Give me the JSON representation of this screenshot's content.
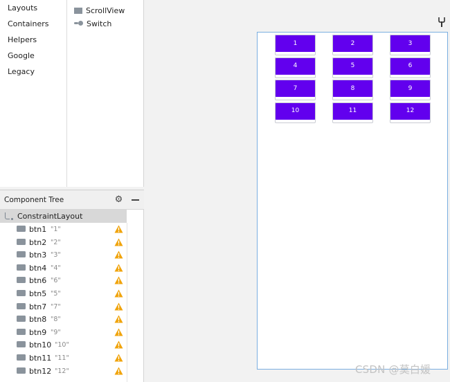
{
  "palette": {
    "categories": [
      "Layouts",
      "Containers",
      "Helpers",
      "Google",
      "Legacy"
    ],
    "items": [
      {
        "label": "ScrollView",
        "icon": "scrollview-icon"
      },
      {
        "label": "Switch",
        "icon": "switch-icon"
      }
    ]
  },
  "component_tree": {
    "title": "Component Tree",
    "root": "ConstraintLayout",
    "rows": [
      {
        "id": "btn1",
        "text": "\"1\""
      },
      {
        "id": "btn2",
        "text": "\"2\""
      },
      {
        "id": "btn3",
        "text": "\"3\""
      },
      {
        "id": "btn4",
        "text": "\"4\""
      },
      {
        "id": "btn6",
        "text": "\"6\""
      },
      {
        "id": "btn5",
        "text": "\"5\""
      },
      {
        "id": "btn7",
        "text": "\"7\""
      },
      {
        "id": "btn8",
        "text": "\"8\""
      },
      {
        "id": "btn9",
        "text": "\"9\""
      },
      {
        "id": "btn10",
        "text": "\"10\""
      },
      {
        "id": "btn11",
        "text": "\"11\""
      },
      {
        "id": "btn12",
        "text": "\"12\""
      }
    ],
    "warning_color": "#f0a30a"
  },
  "design": {
    "buttons": [
      "1",
      "2",
      "3",
      "4",
      "5",
      "6",
      "7",
      "8",
      "9",
      "10",
      "11",
      "12"
    ],
    "button_color": "#6200ee",
    "frame_color": "#7aaee0"
  },
  "watermark": "CSDN @莫白媛"
}
